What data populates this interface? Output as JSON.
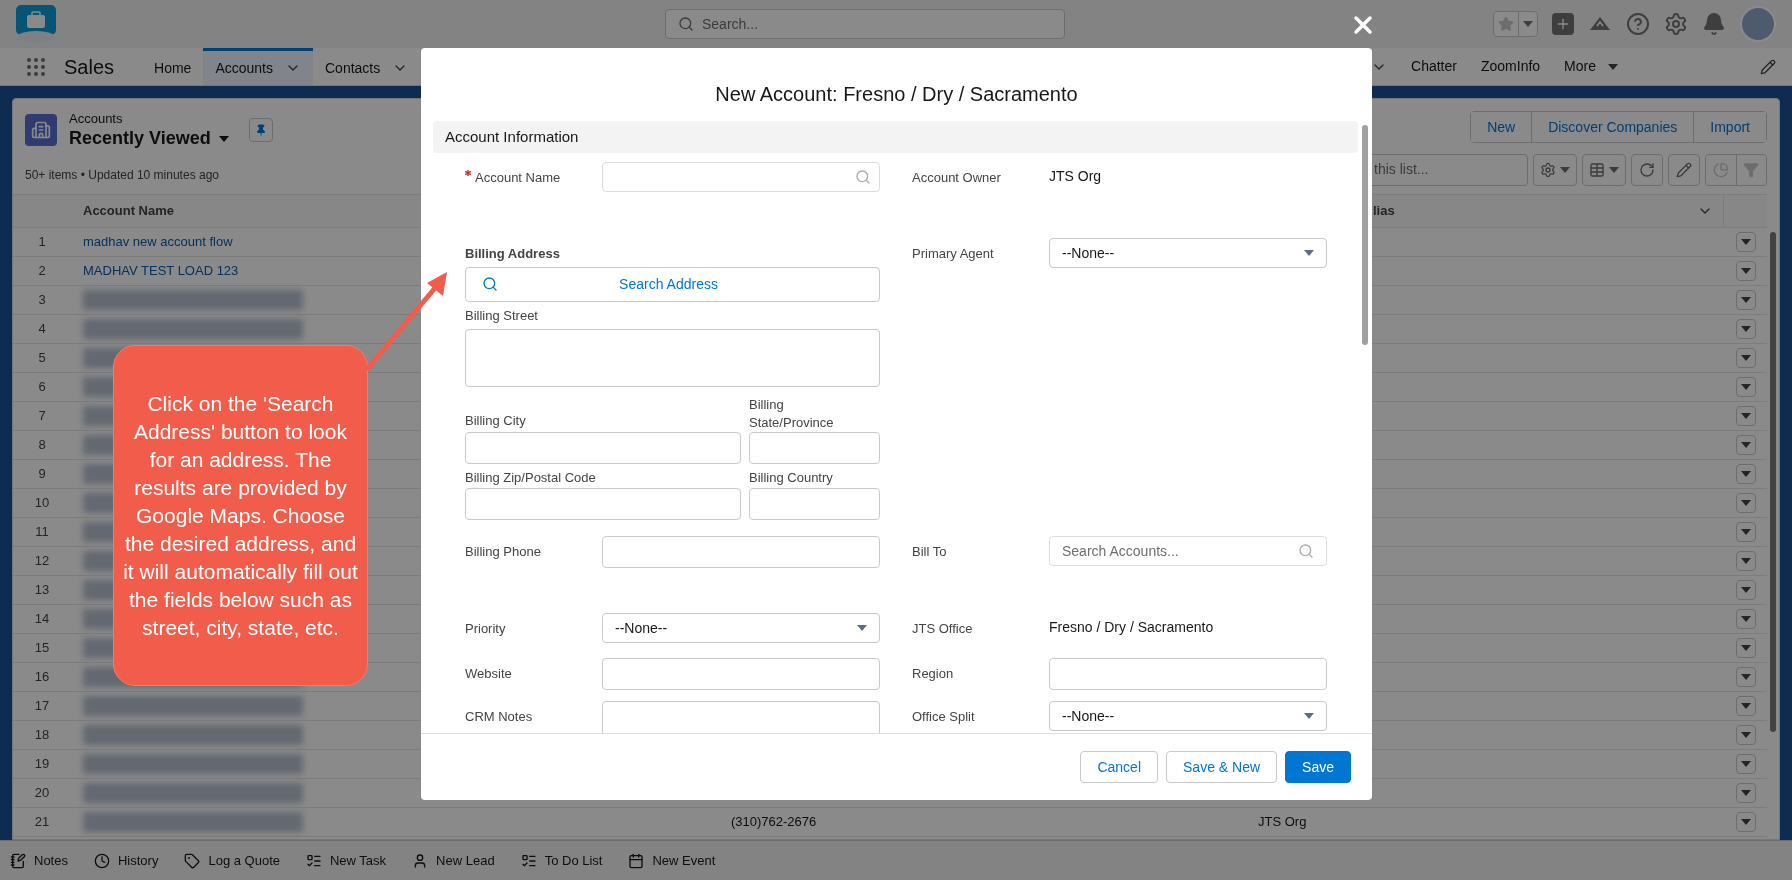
{
  "header": {
    "search_placeholder": "Search..."
  },
  "nav": {
    "app_name": "Sales",
    "tabs": [
      {
        "label": "Home",
        "selected": false,
        "has_menu": false
      },
      {
        "label": "Accounts",
        "selected": true,
        "has_menu": true
      },
      {
        "label": "Contacts",
        "selected": false,
        "has_menu": true
      }
    ],
    "right_tabs": [
      {
        "label": "Chatter",
        "has_menu": false
      },
      {
        "label": "ZoomInfo",
        "has_menu": false
      },
      {
        "label": "More",
        "has_menu": true
      }
    ]
  },
  "list": {
    "object": "Accounts",
    "view": "Recently Viewed",
    "summary": "50+ items • Updated 10 minutes ago",
    "actions": [
      "New",
      "Discover Companies",
      "Import"
    ],
    "search_placeholder": "this list...",
    "columns": [
      "Account Name",
      "lias"
    ],
    "rows": [
      {
        "number": "1",
        "name": "madhav new account flow",
        "blurred": false
      },
      {
        "number": "2",
        "name": "MADHAV TEST LOAD 123",
        "blurred": false
      },
      {
        "number": "3",
        "blurred": true
      },
      {
        "number": "4",
        "blurred": true
      },
      {
        "number": "5",
        "blurred": true
      },
      {
        "number": "6",
        "blurred": true
      },
      {
        "number": "7",
        "blurred": true
      },
      {
        "number": "8",
        "blurred": true
      },
      {
        "number": "9",
        "blurred": true
      },
      {
        "number": "10",
        "blurred": true
      },
      {
        "number": "11",
        "blurred": true
      },
      {
        "number": "12",
        "blurred": true
      },
      {
        "number": "13",
        "blurred": true
      },
      {
        "number": "14",
        "blurred": true
      },
      {
        "number": "15",
        "blurred": true
      },
      {
        "number": "16",
        "blurred": true
      },
      {
        "number": "17",
        "blurred": true
      },
      {
        "number": "18",
        "blurred": true
      },
      {
        "number": "19",
        "blurred": true
      },
      {
        "number": "20",
        "blurred": true
      },
      {
        "number": "21",
        "blurred": true,
        "phone": "(310)762-2676",
        "owner": "JTS Org"
      }
    ]
  },
  "utility_bar": [
    {
      "label": "Notes",
      "kind": "notes"
    },
    {
      "label": "History",
      "kind": "history"
    },
    {
      "label": "Log a Quote",
      "kind": "quote"
    },
    {
      "label": "New Task",
      "kind": "task"
    },
    {
      "label": "New Lead",
      "kind": "lead"
    },
    {
      "label": "To Do List",
      "kind": "todo"
    },
    {
      "label": "New Event",
      "kind": "event"
    }
  ],
  "modal": {
    "title": "New Account: Fresno / Dry / Sacramento",
    "section": "Account Information",
    "account_name": {
      "label": "Account Name",
      "required": true
    },
    "account_owner": {
      "label": "Account Owner",
      "value": "JTS Org"
    },
    "billing_address": {
      "label": "Billing Address",
      "search_button": "Search Address",
      "street": "Billing Street",
      "city": "Billing City",
      "state": "Billing State/Province",
      "zip": "Billing Zip/Postal Code",
      "country": "Billing Country"
    },
    "primary_agent": {
      "label": "Primary Agent",
      "value": "--None--"
    },
    "billing_phone": {
      "label": "Billing Phone"
    },
    "bill_to": {
      "label": "Bill To",
      "placeholder": "Search Accounts..."
    },
    "priority": {
      "label": "Priority",
      "value": "--None--"
    },
    "jts_office": {
      "label": "JTS Office",
      "value": "Fresno / Dry / Sacramento"
    },
    "website": {
      "label": "Website"
    },
    "region": {
      "label": "Region"
    },
    "crm_notes": {
      "label": "CRM Notes"
    },
    "office_split": {
      "label": "Office Split",
      "value": "--None--"
    },
    "buttons": [
      {
        "label": "Cancel",
        "kind": "neutral"
      },
      {
        "label": "Save & New",
        "kind": "neutral"
      },
      {
        "label": "Save",
        "kind": "brand"
      }
    ]
  },
  "annotation": {
    "text": "Click on the 'Search Address' button to look for an address. The results are provided by Google Maps. Choose the desired address, and it will automatically fill out the fields below such as street, city, state, etc."
  }
}
